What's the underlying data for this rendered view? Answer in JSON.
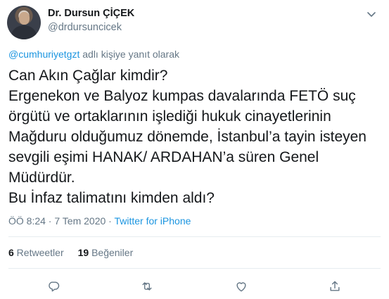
{
  "author": {
    "name": "Dr. Dursun ÇİÇEK",
    "handle": "@drdursuncicek"
  },
  "reply": {
    "mention": "@cumhuriyetgzt",
    "suffix": " adlı kişiye yanıt olarak"
  },
  "tweet": {
    "text": "Can Akın Çağlar kimdir?\nErgenekon ve Balyoz kumpas davalarında FETÖ suç örgütü ve ortaklarının işlediği hukuk cinayetlerinin Mağduru olduğumuz dönemde, İstanbul’a tayin isteyen sevgili eşimi HANAK/ ARDAHAN’a süren Genel Müdürdür.\nBu İnfaz talimatını kimden aldı?",
    "timestamp": "ÖÖ 8:24 · 7 Tem 2020 · ",
    "source": "Twitter for iPhone"
  },
  "stats": {
    "retweets_count": "6",
    "retweets_label": " Retweetler",
    "likes_count": "19",
    "likes_label": " Beğeniler"
  },
  "icons": {
    "more": "chevron-down-icon",
    "reply": "reply-icon",
    "retweet": "retweet-icon",
    "like": "heart-icon",
    "share": "share-icon"
  },
  "colors": {
    "text": "#14171a",
    "muted": "#657786",
    "link": "#1b95e0",
    "divider": "#e6ecf0"
  }
}
